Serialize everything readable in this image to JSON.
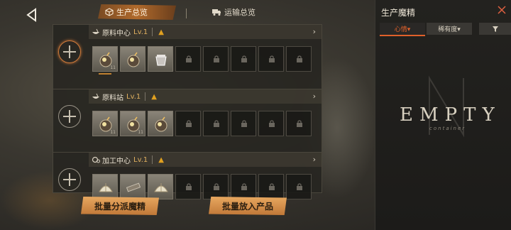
{
  "tabs": {
    "production": "生产总览",
    "transport": "运输总览"
  },
  "panels": [
    {
      "name": "原料中心",
      "level": "Lv.1",
      "filled": [
        "bomb",
        "bomb",
        "jar"
      ],
      "slot_nums": [
        "11",
        "",
        ""
      ]
    },
    {
      "name": "原料站",
      "level": "Lv.1",
      "filled": [
        "bomb",
        "bomb",
        "bomb"
      ],
      "slot_nums": [
        "11",
        "11",
        ""
      ]
    },
    {
      "name": "加工中心",
      "level": "Lv.1",
      "filled": [
        "shell",
        "bar",
        "shell"
      ],
      "slot_nums": [
        "",
        "",
        ""
      ]
    }
  ],
  "buttons": {
    "dispatch": "批量分派魔精",
    "put_products": "批量放入产品"
  },
  "right_panel": {
    "title": "生产魔精",
    "filter_mood": "心情▾",
    "filter_rarity": "稀有度▾",
    "empty_text": "EMPTY",
    "empty_sub": "container"
  },
  "colors": {
    "accent": "#e0602a",
    "button": "#d89050",
    "level": "#e0b060",
    "warning": "#e0a020"
  }
}
